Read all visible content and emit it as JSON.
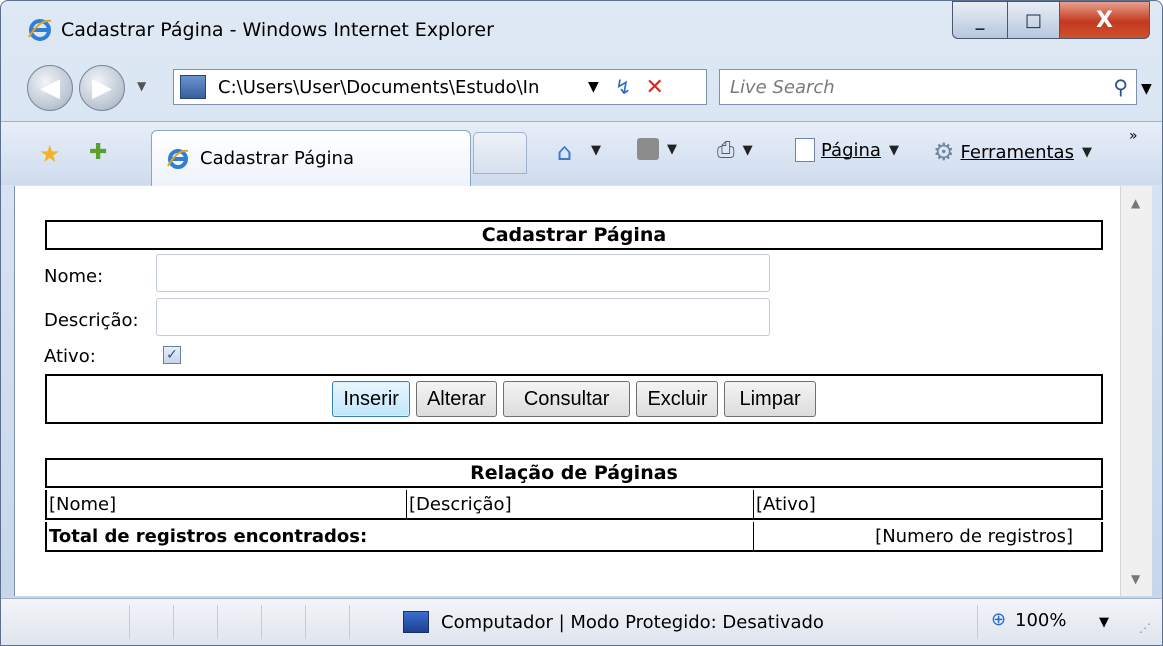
{
  "window": {
    "title": "Cadastrar Página - Windows Internet Explorer",
    "minimize": "_",
    "maximize": "□",
    "close": "X"
  },
  "addressbar": {
    "url": "C:\\Users\\User\\Documents\\Estudo\\In",
    "dropdown": "▼",
    "refresh_icon": "refresh-icon",
    "stop_icon": "stop-icon"
  },
  "search": {
    "placeholder": "Live Search",
    "icon": "search-icon"
  },
  "tabs": [
    {
      "label": "Cadastrar Página"
    }
  ],
  "commandbar": {
    "page_label": "Página",
    "tools_label": "Ferramentas"
  },
  "form": {
    "title": "Cadastrar Página",
    "nome_label": "Nome:",
    "nome_value": "",
    "descricao_label": "Descrição:",
    "descricao_value": "",
    "ativo_label": "Ativo:",
    "ativo_checked": true,
    "buttons": {
      "inserir": "Inserir",
      "alterar": "Alterar",
      "consultar": "Consultar",
      "excluir": "Excluir",
      "limpar": "Limpar"
    }
  },
  "table": {
    "title": "Relação de Páginas",
    "columns": [
      "[Nome]",
      "[Descrição]",
      "[Ativo]"
    ],
    "total_label": "Total de registros encontrados:",
    "total_value": "[Numero de registros]"
  },
  "statusbar": {
    "zone_text": "Computador | Modo Protegido: Desativado",
    "zoom": "100%"
  }
}
